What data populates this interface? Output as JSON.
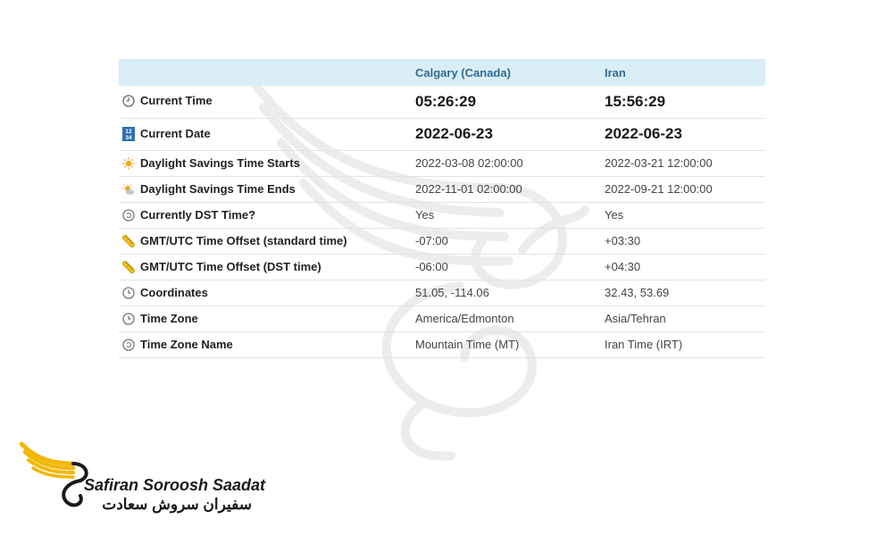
{
  "header": {
    "col1": "",
    "col2": "Calgary (Canada)",
    "col3": "Iran"
  },
  "rows": [
    {
      "icon": "clock-icon",
      "label": "Current Time",
      "a": "05:26:29",
      "b": "15:56:29"
    },
    {
      "icon": "calendar-icon",
      "label": "Current Date",
      "a": "2022-06-23",
      "b": "2022-06-23"
    },
    {
      "icon": "sun-icon",
      "label": "Daylight Savings Time Starts",
      "a": "2022-03-08 02:00:00",
      "b": "2022-03-21 12:00:00"
    },
    {
      "icon": "cloud-sun-icon",
      "label": "Daylight Savings Time Ends",
      "a": "2022-11-01 02:00:00",
      "b": "2022-09-21 12:00:00"
    },
    {
      "icon": "dst-clock-icon",
      "label": "Currently DST Time?",
      "a": "Yes",
      "b": "Yes"
    },
    {
      "icon": "ruler-icon",
      "label": "GMT/UTC Time Offset (standard time)",
      "a": "-07:00",
      "b": "+03:30"
    },
    {
      "icon": "ruler-icon",
      "label": "GMT/UTC Time Offset (DST time)",
      "a": "-06:00",
      "b": "+04:30"
    },
    {
      "icon": "clock-icon",
      "label": "Coordinates",
      "a": "51.05, -114.06",
      "b": "32.43, 53.69"
    },
    {
      "icon": "clock-icon",
      "label": "Time Zone",
      "a": "America/Edmonton",
      "b": "Asia/Tehran"
    },
    {
      "icon": "dst-clock-icon",
      "label": "Time Zone Name",
      "a": "Mountain Time (MT)",
      "b": "Iran Time (IRT)"
    }
  ],
  "calendar_icon_text": [
    "12",
    "34"
  ],
  "logo": {
    "english": "Safiran Soroosh Saadat",
    "persian": "سفیران سروش سعادت"
  },
  "colors": {
    "header_bg": "#d9eef7",
    "header_text": "#336b94",
    "logo_gold": "#f2b705",
    "row_border": "#e3e3e3"
  }
}
